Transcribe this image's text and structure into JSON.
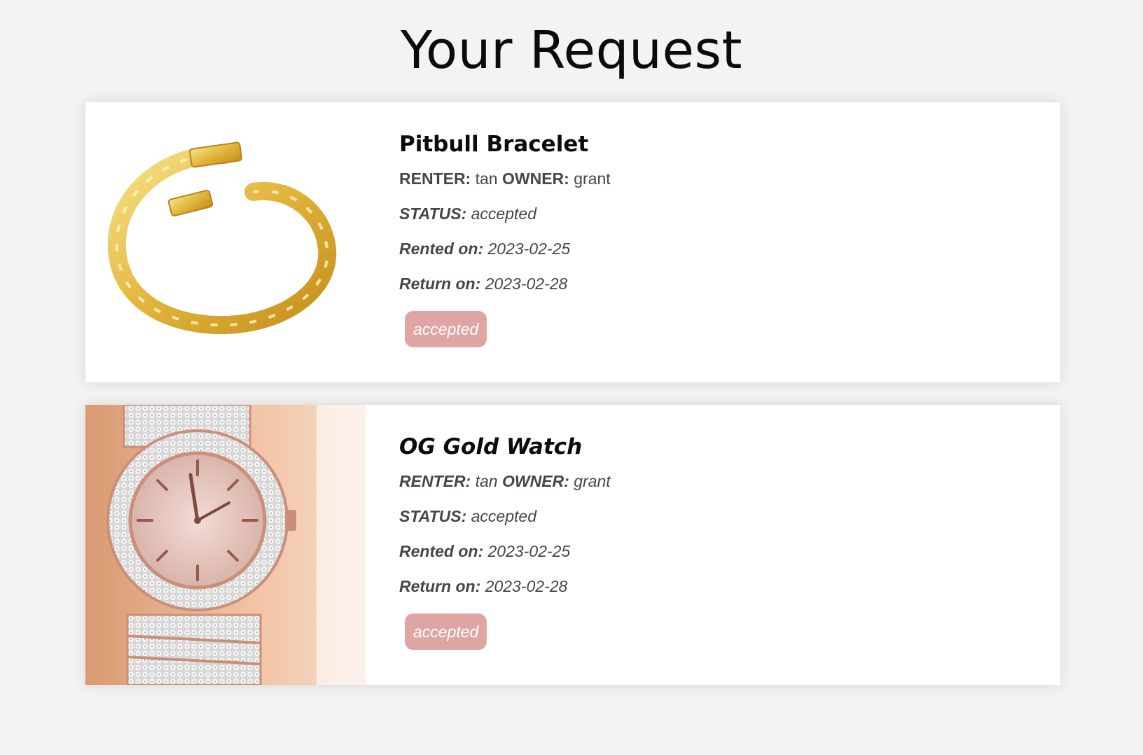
{
  "page": {
    "title": "Your Request"
  },
  "requests": [
    {
      "item_name": "Pitbull Bracelet",
      "renter_label": "RENTER:",
      "renter": "tan",
      "owner_label": "OWNER:",
      "owner": "grant",
      "status_label": "STATUS:",
      "status": "accepted",
      "rented_label": "Rented on:",
      "rented_on": "2023-02-25",
      "return_label": "Return on:",
      "return_on": "2023-02-28",
      "badge": "accepted",
      "image_icon": "gold-chain-bracelet"
    },
    {
      "item_name": "OG Gold Watch",
      "renter_label": "RENTER:",
      "renter": "tan",
      "owner_label": "OWNER:",
      "owner": "grant",
      "status_label": "STATUS:",
      "status": "accepted",
      "rented_label": "Rented on:",
      "rented_on": "2023-02-25",
      "return_label": "Return on:",
      "return_on": "2023-02-28",
      "badge": "accepted",
      "image_icon": "diamond-wrist-watch"
    }
  ],
  "colors": {
    "background": "#f3f3f3",
    "card": "#ffffff",
    "badge": "#dfa5a5",
    "text": "#4a4545"
  }
}
